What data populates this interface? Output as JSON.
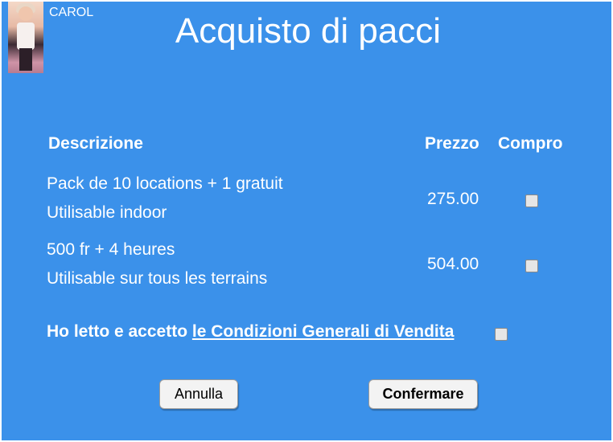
{
  "user": {
    "name": "CAROL",
    "avatar_icon": "user-photo-icon"
  },
  "page": {
    "title": "Acquisto di pacci"
  },
  "table": {
    "columns": [
      "Descrizione",
      "Prezzo",
      "Compro"
    ],
    "rows": [
      {
        "description_line1": "Pack de 10 locations + 1 gratuit",
        "description_line2": "Utilisable indoor",
        "price": "275.00",
        "selected": false
      },
      {
        "description_line1": "500 fr + 4 heures",
        "description_line2": "Utilisable sur tous les terrains",
        "price": "504.00",
        "selected": false
      }
    ]
  },
  "terms": {
    "prefix": "Ho letto e accetto ",
    "link_text": "le Condizioni Generali di Vendita",
    "accepted": false
  },
  "buttons": {
    "cancel_label": "Annulla",
    "confirm_label": "Confermare"
  },
  "colors": {
    "panel_background": "#3b91ea",
    "text": "#ffffff",
    "button_background": "#f3f3f3"
  }
}
